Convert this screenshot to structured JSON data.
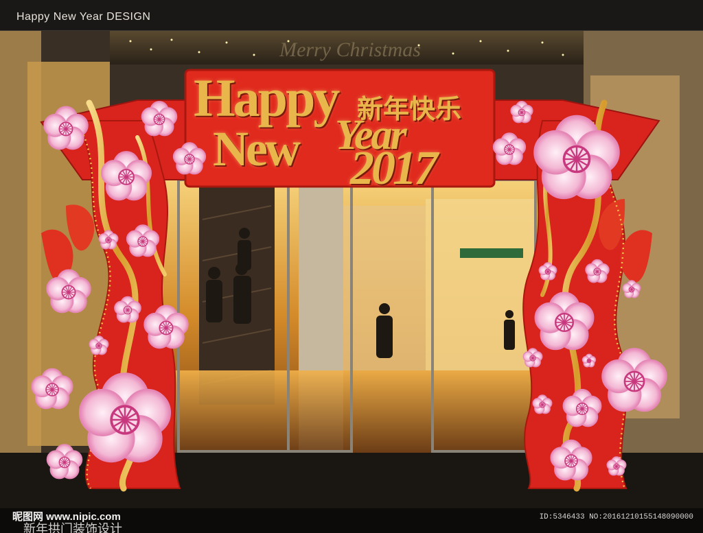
{
  "window": {
    "title": "Happy New Year DESIGN"
  },
  "banner": {
    "line1": "Happy",
    "line2": "New",
    "line3": "Year",
    "cn_greeting": "新年快乐",
    "year": "2017"
  },
  "mall_sign": "Merry Christmas",
  "footer": {
    "watermark": "昵图网 www.nipic.com",
    "caption": "新年拱门装饰设计",
    "image_id": "ID:5346433 NO:20161210155148090000"
  },
  "colors": {
    "arch_red": "#d8241c",
    "gold": "#e8b64a",
    "blossom_pink": "#f3b8d4",
    "blossom_center": "#c8387e"
  }
}
